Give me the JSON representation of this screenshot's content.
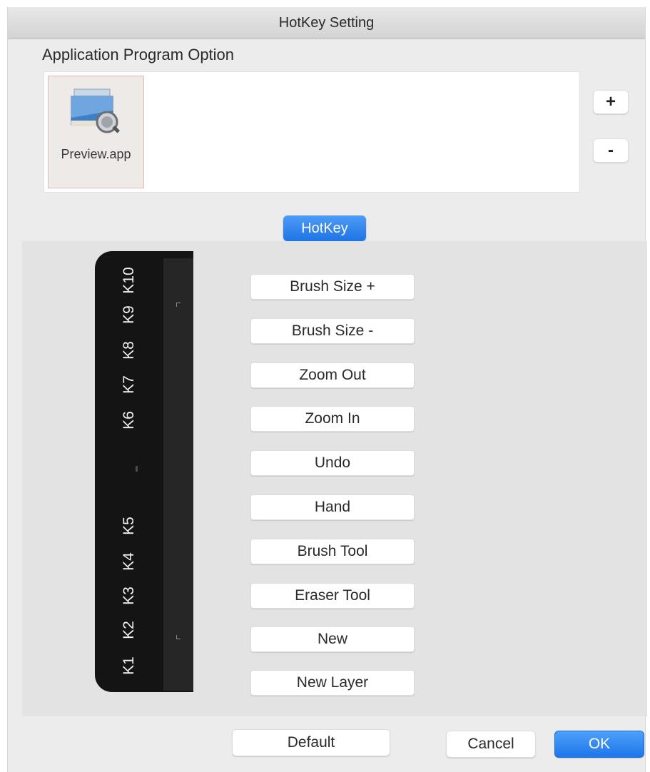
{
  "window": {
    "title": "HotKey Setting"
  },
  "app_section": {
    "label": "Application Program Option",
    "apps": [
      {
        "name": "Preview.app",
        "icon": "preview-app-icon"
      }
    ],
    "add_label": "+",
    "remove_label": "-"
  },
  "tab": {
    "label": "HotKey"
  },
  "tablet": {
    "keys_top": [
      "K10",
      "K9",
      "K8",
      "K7",
      "K6"
    ],
    "keys_bottom": [
      "K5",
      "K4",
      "K3",
      "K2",
      "K1"
    ]
  },
  "hotkeys": [
    "Brush Size +",
    "Brush Size -",
    "Zoom Out",
    "Zoom In",
    "Undo",
    "Hand",
    "Brush Tool",
    "Eraser Tool",
    "New",
    "New Layer"
  ],
  "footer": {
    "default_label": "Default",
    "cancel_label": "Cancel",
    "ok_label": "OK"
  },
  "colors": {
    "accent": "#1f74e6",
    "tablet": "#141414",
    "panel": "#e3e3e3"
  }
}
